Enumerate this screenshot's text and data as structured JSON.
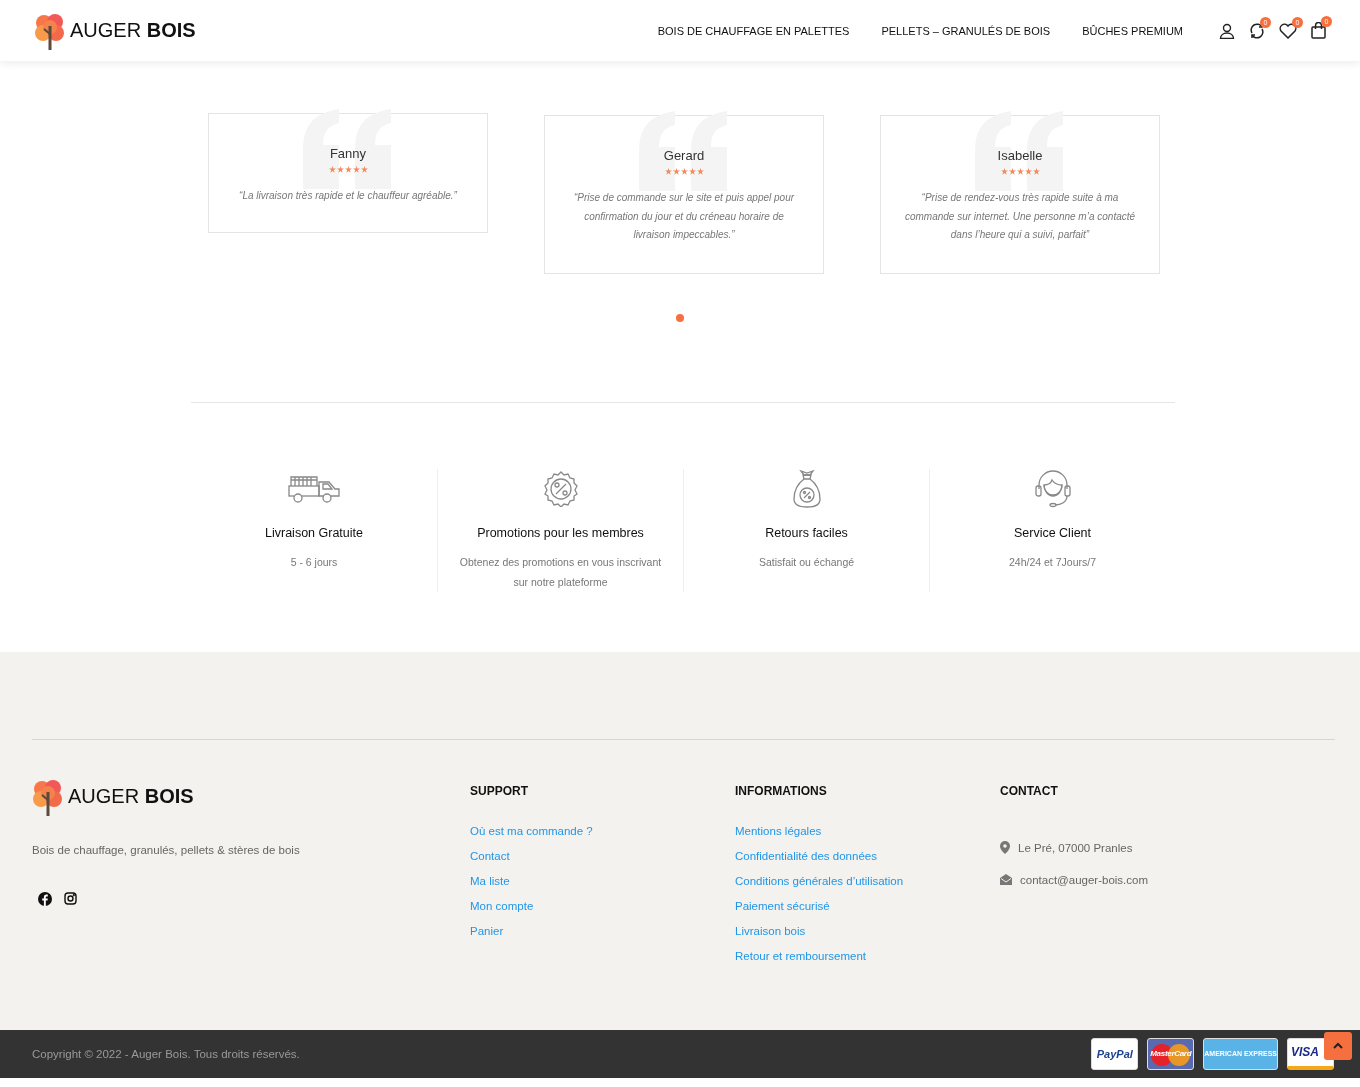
{
  "header": {
    "logo": {
      "word1": "AUGER",
      "word2": "BOIS"
    },
    "nav": [
      {
        "label": "BOIS DE CHAUFFAGE EN PALETTES"
      },
      {
        "label": "PELLETS – GRANULÉS DE BOIS"
      },
      {
        "label": "BÛCHES PREMIUM"
      }
    ],
    "icons": [
      {
        "kind": "account"
      },
      {
        "kind": "compare",
        "badge": "0"
      },
      {
        "kind": "wishlist",
        "badge": "0"
      },
      {
        "kind": "cart",
        "badge": "0"
      }
    ]
  },
  "testimonials": {
    "items": [
      {
        "name": "Fanny",
        "stars": 5,
        "quote": "“La livraison très rapide et le chauffeur agréable.”"
      },
      {
        "name": "Gerard",
        "stars": 5,
        "quote": "“Prise de commande sur le site et puis appel pour confirmation du jour et du créneau horaire de livraison impeccables.”"
      },
      {
        "name": "Isabelle",
        "stars": 5,
        "quote": "“Prise de rendez-vous très rapide suite à ma commande sur internet. Une personne m’a contacté dans l’heure qui a suivi, parfait”"
      }
    ],
    "dots": [
      {
        "selected": true
      }
    ]
  },
  "features": [
    {
      "kind": "truck",
      "title": "Livraison Gratuite",
      "text": "5 - 6 jours"
    },
    {
      "kind": "discount",
      "title": "Promotions pour les membres",
      "text": "Obtenez des promotions en vous inscrivant sur notre plateforme"
    },
    {
      "kind": "bag",
      "title": "Retours faciles",
      "text": "Satisfait ou échangé"
    },
    {
      "kind": "headset",
      "title": "Service Client",
      "text": "24h/24 et 7Jours/7"
    }
  ],
  "footer": {
    "logo": {
      "word1": "AUGER",
      "word2": "BOIS"
    },
    "tagline": "Bois de chauffage, granulés, pellets & stères de bois",
    "social": [
      {
        "kind": "facebook"
      },
      {
        "kind": "instagram"
      }
    ],
    "columns": [
      {
        "title": "SUPPORT",
        "links": [
          "Où est ma commande ?",
          "Contact",
          "Ma liste",
          "Mon compte",
          "Panier"
        ]
      },
      {
        "title": "INFORMATIONS",
        "links": [
          "Mentions légales",
          "Confidentialité des données",
          "Conditions générales d’utilisation",
          "Paiement sécurisé",
          "Livraison bois",
          "Retour et remboursement"
        ]
      }
    ],
    "contact": {
      "title": "CONTACT",
      "items": [
        {
          "kind": "location",
          "text": "Le Pré, 07000 Pranles"
        },
        {
          "kind": "email",
          "text": "contact@auger-bois.com"
        }
      ]
    }
  },
  "bottom_bar": {
    "copyright": "Copyright © 2022 - Auger Bois. Tous droits réservés.",
    "payments": [
      {
        "kind": "paypal",
        "label": "PayPal"
      },
      {
        "kind": "mastercard",
        "label": "MasterCard"
      },
      {
        "kind": "amex",
        "label": "AMERICAN EXPRESS"
      },
      {
        "kind": "visa",
        "label": "VISA"
      }
    ]
  }
}
